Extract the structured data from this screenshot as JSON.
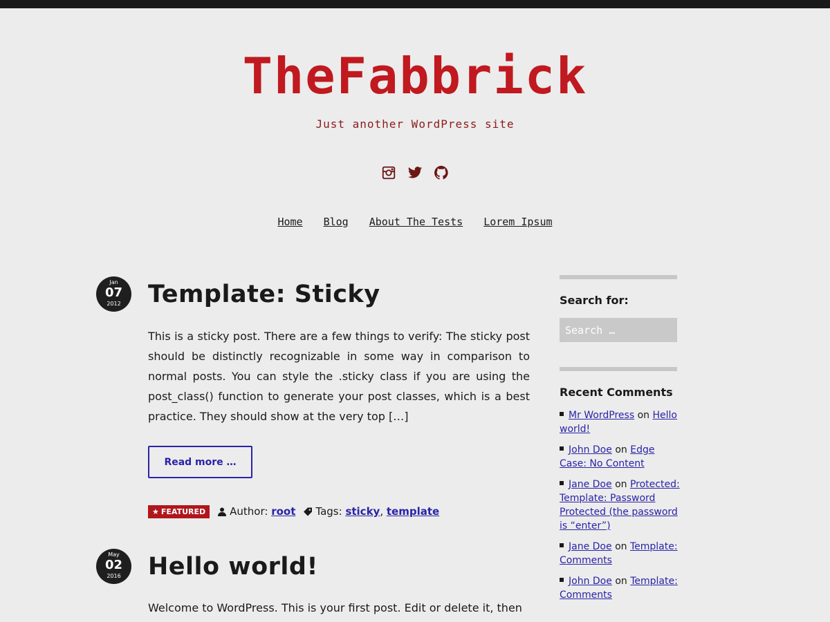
{
  "site": {
    "title": "TheFabbrick",
    "tagline": "Just another WordPress site"
  },
  "social": [
    {
      "icon": "instagram-icon"
    },
    {
      "icon": "twitter-icon"
    },
    {
      "icon": "github-icon"
    }
  ],
  "nav": {
    "items": [
      "Home",
      "Blog",
      "About The Tests",
      "Lorem Ipsum"
    ]
  },
  "posts": [
    {
      "month": "Jan",
      "day": "07",
      "year": "2012",
      "title": "Template: Sticky",
      "excerpt": "This is a sticky post. There are a few things to verify: The sticky post should be distinctly recognizable in some way in comparison to normal posts. You can style the .sticky class if you are using the post_class() function to generate your post classes, which is a best practice. They should show at the very top […]",
      "read_more": "Read more …",
      "featured": "FEATURED",
      "author_label": "Author:",
      "author": "root",
      "tags_label": "Tags:",
      "tags": [
        "sticky",
        "template"
      ],
      "tag_separator": ","
    },
    {
      "month": "May",
      "day": "02",
      "year": "2016",
      "title": "Hello world!",
      "excerpt": "Welcome to WordPress. This is your first post. Edit or delete it, then"
    }
  ],
  "sidebar": {
    "search": {
      "title": "Search for:",
      "placeholder": "Search …"
    },
    "recent_comments": {
      "title": "Recent Comments",
      "on_word": "on",
      "items": [
        {
          "author": "Mr WordPress",
          "post": "Hello world!"
        },
        {
          "author": "John Doe",
          "post": "Edge Case: No Content"
        },
        {
          "author": "Jane Doe",
          "post": "Protected: Template: Password Protected (the password is “enter”)"
        },
        {
          "author": "Jane Doe",
          "post": "Template: Comments"
        },
        {
          "author": "John Doe",
          "post": "Template: Comments"
        }
      ]
    }
  }
}
